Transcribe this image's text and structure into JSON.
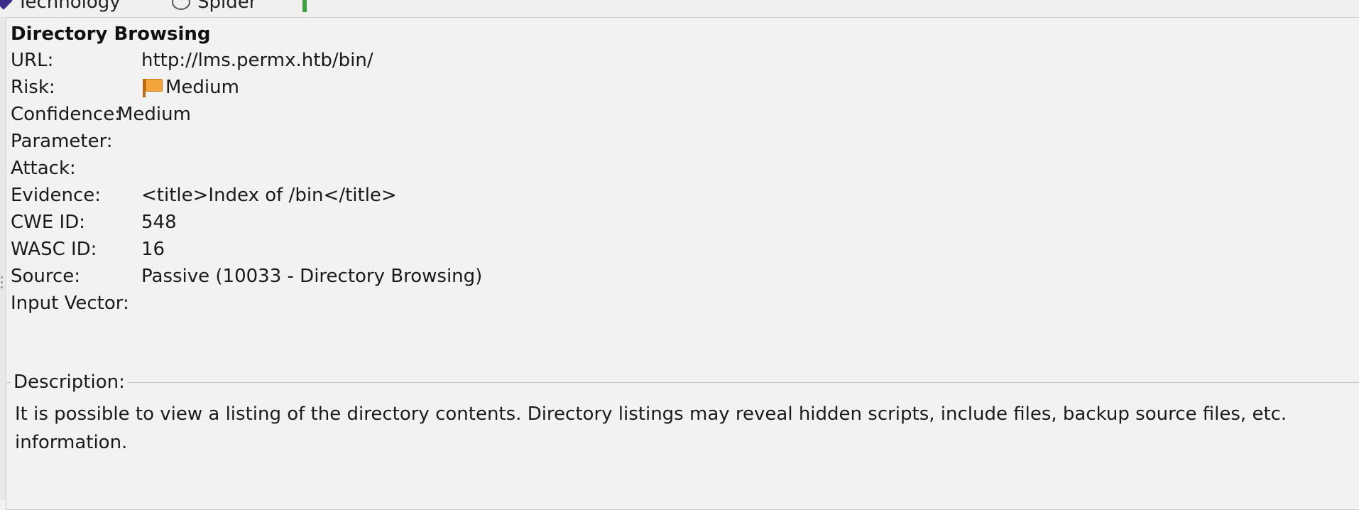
{
  "tabs": [
    {
      "label": "Technology",
      "icon": "diamond-icon"
    },
    {
      "label": "Spider",
      "icon": "spider-icon"
    },
    {
      "label": "",
      "icon": "green-bar-icon"
    }
  ],
  "alert": {
    "title": "Directory Browsing",
    "fields": [
      {
        "label": "URL:",
        "value": "http://lms.permx.htb/bin/"
      },
      {
        "label": "Risk:",
        "value": "Medium",
        "icon": "risk-flag-icon",
        "icon_color": "#f4a63a"
      },
      {
        "label": "Confidence:",
        "value": "Medium"
      },
      {
        "label": "Parameter:",
        "value": ""
      },
      {
        "label": "Attack:",
        "value": ""
      },
      {
        "label": "Evidence:",
        "value": "<title>Index of /bin</title>"
      },
      {
        "label": "CWE ID:",
        "value": "548"
      },
      {
        "label": "WASC ID:",
        "value": "16"
      },
      {
        "label": "Source:",
        "value": "Passive (10033 - Directory Browsing)"
      },
      {
        "label": "Input Vector:",
        "value": ""
      }
    ],
    "description": {
      "legend": "Description:",
      "lines": [
        "It is possible to view a listing of the directory contents. Directory listings may reveal hidden scripts, include files, backup source files, etc.",
        "information."
      ]
    }
  }
}
